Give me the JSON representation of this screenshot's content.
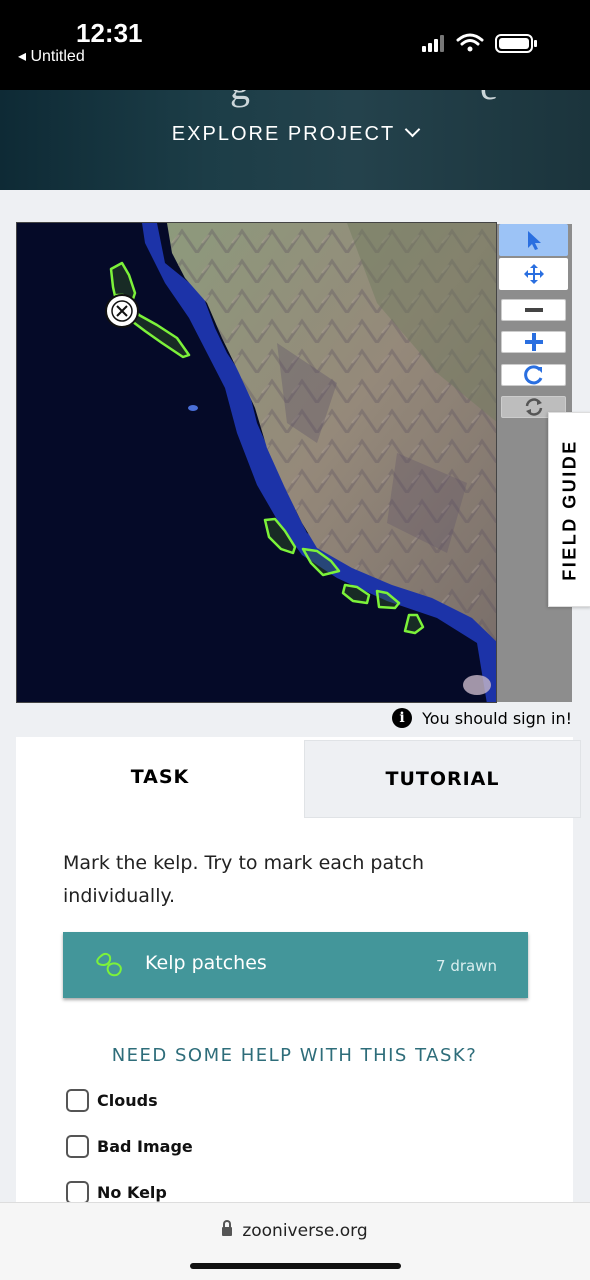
{
  "status_bar": {
    "time": "12:31",
    "back_label": "◂ Untitled"
  },
  "header": {
    "explore_label": "EXPLORE PROJECT"
  },
  "subject": {
    "kelp_patches_drawn": 7,
    "colors": {
      "ocean": "#050a28",
      "coast_water": "#1a2fa0",
      "land": "#8a8872",
      "outline": "#7cf23a"
    }
  },
  "toolbar": {
    "buttons": [
      {
        "icon": "cursor-icon",
        "state": "active"
      },
      {
        "icon": "move-icon",
        "state": "normal"
      },
      {
        "icon": "zoom-out-icon",
        "state": "normal"
      },
      {
        "icon": "zoom-in-icon",
        "state": "normal"
      },
      {
        "icon": "rotate-icon",
        "state": "normal"
      },
      {
        "icon": "reset-icon",
        "state": "disabled"
      }
    ]
  },
  "field_guide": {
    "label": "FIELD GUIDE"
  },
  "sign_in": {
    "text": "You should sign in!"
  },
  "task_panel": {
    "tabs": [
      {
        "label": "TASK",
        "active": true
      },
      {
        "label": "TUTORIAL",
        "active": false
      }
    ],
    "instruction": "Mark the kelp. Try to mark each patch individually.",
    "tool": {
      "label": "Kelp patches",
      "count": "7 drawn",
      "color": "#43969a",
      "icon": "kelp-polygon-icon"
    },
    "help_link": "NEED SOME HELP WITH THIS TASK?",
    "checkboxes": [
      {
        "label": "Clouds",
        "checked": false
      },
      {
        "label": "Bad Image",
        "checked": false
      },
      {
        "label": "No Kelp",
        "checked": false
      }
    ]
  },
  "browser": {
    "url": "zooniverse.org"
  }
}
